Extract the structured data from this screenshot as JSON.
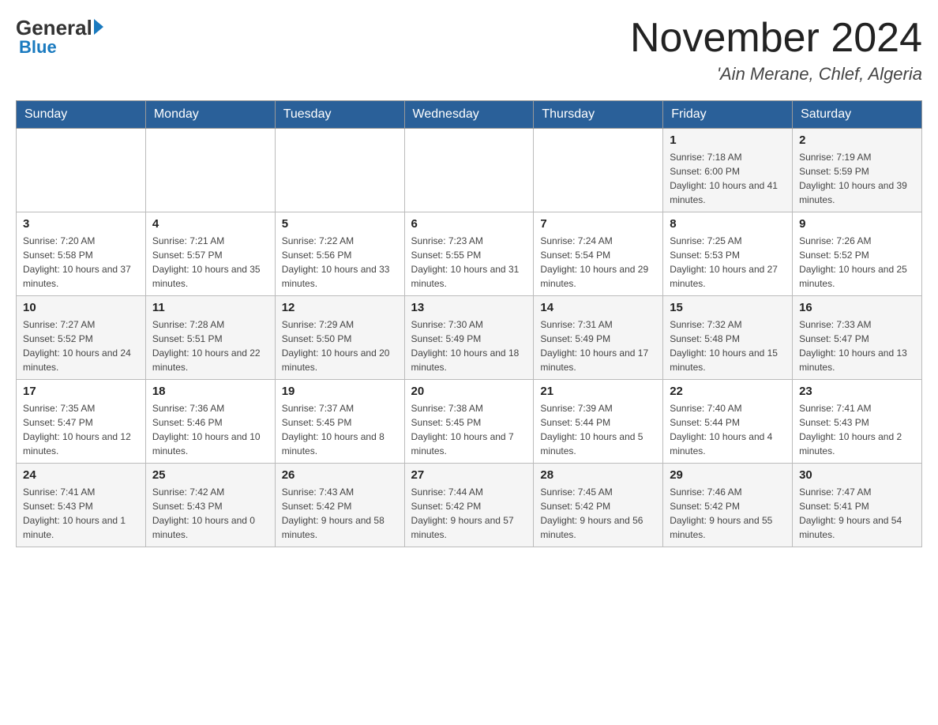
{
  "header": {
    "logo_general": "General",
    "logo_blue": "Blue",
    "month_title": "November 2024",
    "location": "'Ain Merane, Chlef, Algeria"
  },
  "calendar": {
    "days_of_week": [
      "Sunday",
      "Monday",
      "Tuesday",
      "Wednesday",
      "Thursday",
      "Friday",
      "Saturday"
    ],
    "weeks": [
      [
        {
          "day": "",
          "info": ""
        },
        {
          "day": "",
          "info": ""
        },
        {
          "day": "",
          "info": ""
        },
        {
          "day": "",
          "info": ""
        },
        {
          "day": "",
          "info": ""
        },
        {
          "day": "1",
          "info": "Sunrise: 7:18 AM\nSunset: 6:00 PM\nDaylight: 10 hours and 41 minutes."
        },
        {
          "day": "2",
          "info": "Sunrise: 7:19 AM\nSunset: 5:59 PM\nDaylight: 10 hours and 39 minutes."
        }
      ],
      [
        {
          "day": "3",
          "info": "Sunrise: 7:20 AM\nSunset: 5:58 PM\nDaylight: 10 hours and 37 minutes."
        },
        {
          "day": "4",
          "info": "Sunrise: 7:21 AM\nSunset: 5:57 PM\nDaylight: 10 hours and 35 minutes."
        },
        {
          "day": "5",
          "info": "Sunrise: 7:22 AM\nSunset: 5:56 PM\nDaylight: 10 hours and 33 minutes."
        },
        {
          "day": "6",
          "info": "Sunrise: 7:23 AM\nSunset: 5:55 PM\nDaylight: 10 hours and 31 minutes."
        },
        {
          "day": "7",
          "info": "Sunrise: 7:24 AM\nSunset: 5:54 PM\nDaylight: 10 hours and 29 minutes."
        },
        {
          "day": "8",
          "info": "Sunrise: 7:25 AM\nSunset: 5:53 PM\nDaylight: 10 hours and 27 minutes."
        },
        {
          "day": "9",
          "info": "Sunrise: 7:26 AM\nSunset: 5:52 PM\nDaylight: 10 hours and 25 minutes."
        }
      ],
      [
        {
          "day": "10",
          "info": "Sunrise: 7:27 AM\nSunset: 5:52 PM\nDaylight: 10 hours and 24 minutes."
        },
        {
          "day": "11",
          "info": "Sunrise: 7:28 AM\nSunset: 5:51 PM\nDaylight: 10 hours and 22 minutes."
        },
        {
          "day": "12",
          "info": "Sunrise: 7:29 AM\nSunset: 5:50 PM\nDaylight: 10 hours and 20 minutes."
        },
        {
          "day": "13",
          "info": "Sunrise: 7:30 AM\nSunset: 5:49 PM\nDaylight: 10 hours and 18 minutes."
        },
        {
          "day": "14",
          "info": "Sunrise: 7:31 AM\nSunset: 5:49 PM\nDaylight: 10 hours and 17 minutes."
        },
        {
          "day": "15",
          "info": "Sunrise: 7:32 AM\nSunset: 5:48 PM\nDaylight: 10 hours and 15 minutes."
        },
        {
          "day": "16",
          "info": "Sunrise: 7:33 AM\nSunset: 5:47 PM\nDaylight: 10 hours and 13 minutes."
        }
      ],
      [
        {
          "day": "17",
          "info": "Sunrise: 7:35 AM\nSunset: 5:47 PM\nDaylight: 10 hours and 12 minutes."
        },
        {
          "day": "18",
          "info": "Sunrise: 7:36 AM\nSunset: 5:46 PM\nDaylight: 10 hours and 10 minutes."
        },
        {
          "day": "19",
          "info": "Sunrise: 7:37 AM\nSunset: 5:45 PM\nDaylight: 10 hours and 8 minutes."
        },
        {
          "day": "20",
          "info": "Sunrise: 7:38 AM\nSunset: 5:45 PM\nDaylight: 10 hours and 7 minutes."
        },
        {
          "day": "21",
          "info": "Sunrise: 7:39 AM\nSunset: 5:44 PM\nDaylight: 10 hours and 5 minutes."
        },
        {
          "day": "22",
          "info": "Sunrise: 7:40 AM\nSunset: 5:44 PM\nDaylight: 10 hours and 4 minutes."
        },
        {
          "day": "23",
          "info": "Sunrise: 7:41 AM\nSunset: 5:43 PM\nDaylight: 10 hours and 2 minutes."
        }
      ],
      [
        {
          "day": "24",
          "info": "Sunrise: 7:41 AM\nSunset: 5:43 PM\nDaylight: 10 hours and 1 minute."
        },
        {
          "day": "25",
          "info": "Sunrise: 7:42 AM\nSunset: 5:43 PM\nDaylight: 10 hours and 0 minutes."
        },
        {
          "day": "26",
          "info": "Sunrise: 7:43 AM\nSunset: 5:42 PM\nDaylight: 9 hours and 58 minutes."
        },
        {
          "day": "27",
          "info": "Sunrise: 7:44 AM\nSunset: 5:42 PM\nDaylight: 9 hours and 57 minutes."
        },
        {
          "day": "28",
          "info": "Sunrise: 7:45 AM\nSunset: 5:42 PM\nDaylight: 9 hours and 56 minutes."
        },
        {
          "day": "29",
          "info": "Sunrise: 7:46 AM\nSunset: 5:42 PM\nDaylight: 9 hours and 55 minutes."
        },
        {
          "day": "30",
          "info": "Sunrise: 7:47 AM\nSunset: 5:41 PM\nDaylight: 9 hours and 54 minutes."
        }
      ]
    ]
  }
}
